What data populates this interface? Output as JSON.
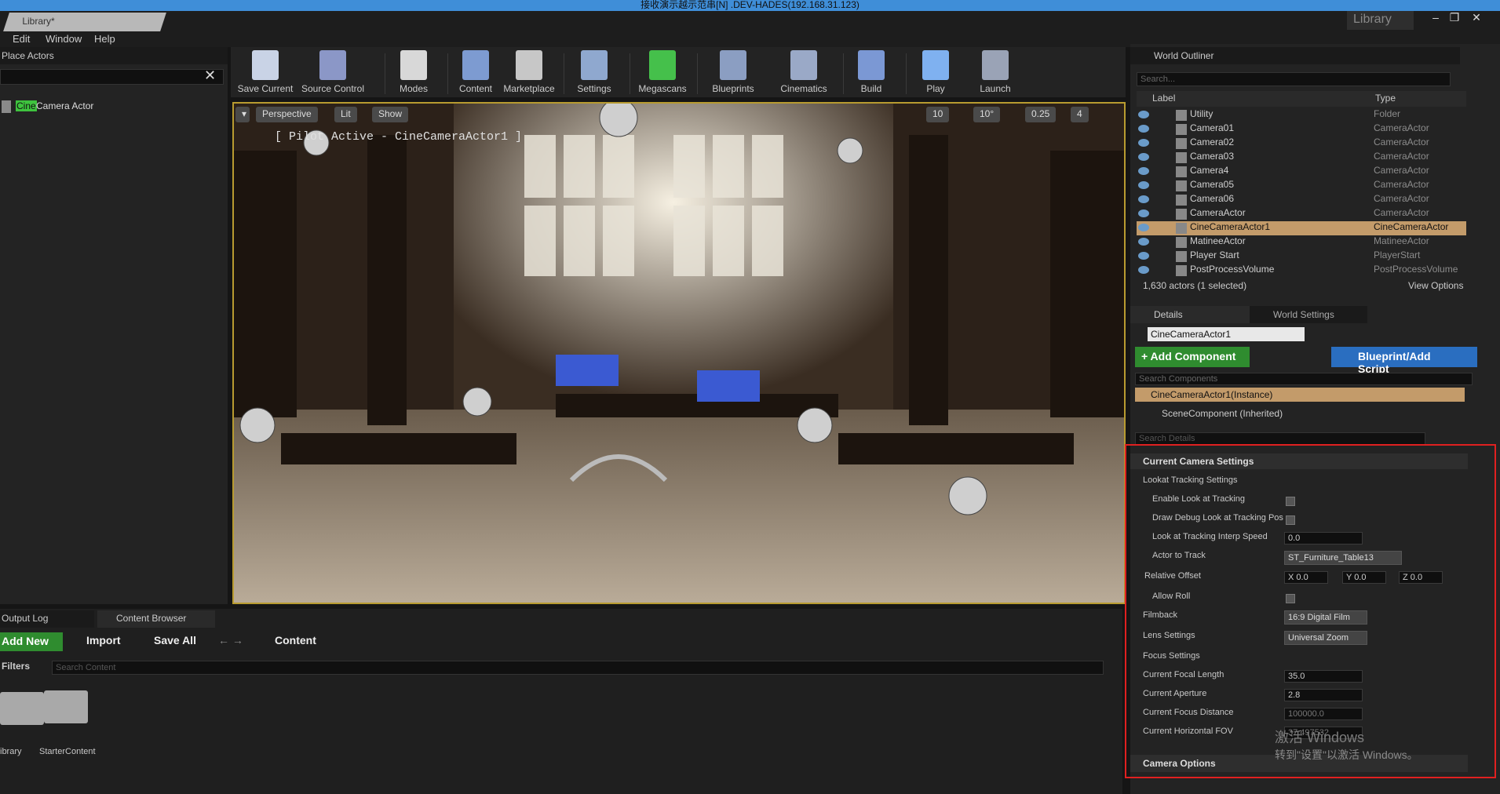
{
  "window": {
    "title": "接收演示越示范串[N] .DEV-HADES(192.168.31.123)",
    "library_tab": "Library*",
    "library_right": "Library"
  },
  "menu": [
    "Edit",
    "Window",
    "Help"
  ],
  "place_actors": {
    "tab": "Place Actors",
    "item_highlight": "Cine",
    "item_rest": " Camera Actor"
  },
  "toolbar": [
    {
      "label": "Save Current",
      "icon": "save-icon",
      "color": "#c9d3e6"
    },
    {
      "label": "Source Control",
      "icon": "source-control-icon",
      "color": "#8b97c7"
    },
    {
      "label": "Modes",
      "icon": "modes-icon",
      "color": "#d8d8d8"
    },
    {
      "label": "Content",
      "icon": "content-icon",
      "color": "#7d9bd1"
    },
    {
      "label": "Marketplace",
      "icon": "marketplace-icon",
      "color": "#c7c7c7"
    },
    {
      "label": "Settings",
      "icon": "settings-icon",
      "color": "#8fa8cf"
    },
    {
      "label": "Megascans",
      "icon": "megascans-icon",
      "color": "#45c04b"
    },
    {
      "label": "Blueprints",
      "icon": "blueprints-icon",
      "color": "#8b9ec2"
    },
    {
      "label": "Cinematics",
      "icon": "cinematics-icon",
      "color": "#9aa9c7"
    },
    {
      "label": "Build",
      "icon": "build-icon",
      "color": "#7b98d4"
    },
    {
      "label": "Play",
      "icon": "play-icon",
      "color": "#7fb1f0"
    },
    {
      "label": "Launch",
      "icon": "launch-icon",
      "color": "#9aa3b6"
    }
  ],
  "viewport": {
    "perspective": "Perspective",
    "lit": "Lit",
    "show": "Show",
    "pilot_text": "[ Pilot Active - CineCameraActor1 ]",
    "snap_grid": "10",
    "snap_rot": "10°",
    "snap_scale": "0.25",
    "cam_speed": "4"
  },
  "outliner": {
    "tab": "World Outliner",
    "search_placeholder": "Search...",
    "col_label": "Label",
    "col_type": "Type",
    "rows": [
      {
        "label": "Utility",
        "type": "Folder"
      },
      {
        "label": "Camera01",
        "type": "CameraActor"
      },
      {
        "label": "Camera02",
        "type": "CameraActor"
      },
      {
        "label": "Camera03",
        "type": "CameraActor"
      },
      {
        "label": "Camera4",
        "type": "CameraActor"
      },
      {
        "label": "Camera05",
        "type": "CameraActor"
      },
      {
        "label": "Camera06",
        "type": "CameraActor"
      },
      {
        "label": "CameraActor",
        "type": "CameraActor"
      },
      {
        "label": "CineCameraActor1",
        "type": "CineCameraActor"
      },
      {
        "label": "MatineeActor",
        "type": "MatineeActor"
      },
      {
        "label": "Player Start",
        "type": "PlayerStart"
      },
      {
        "label": "PostProcessVolume",
        "type": "PostProcessVolume"
      }
    ],
    "status": "1,630 actors (1 selected)",
    "view_options": "View Options"
  },
  "details": {
    "tab_details": "Details",
    "tab_world": "World Settings",
    "actor_name": "CineCameraActor1",
    "add_component": "+ Add Component",
    "blueprint_script": "Blueprint/Add Script",
    "search_components": "Search Components",
    "instance": "CineCameraActor1(Instance)",
    "scene_component": "SceneComponent (Inherited)",
    "search_details": "Search Details",
    "current_camera_settings": "Current Camera Settings",
    "lookat_tracking": "Lookat Tracking Settings",
    "enable_look": "Enable Look at Tracking",
    "draw_debug": "Draw Debug Look at Tracking Pos",
    "interp_speed_label": "Look at Tracking Interp Speed",
    "interp_speed": "0.0",
    "actor_to_track_label": "Actor to Track",
    "actor_to_track": "ST_Furniture_Table13",
    "relative_offset_label": "Relative Offset",
    "offset_x": "X 0.0",
    "offset_y": "Y 0.0",
    "offset_z": "Z 0.0",
    "allow_roll": "Allow Roll",
    "filmback_label": "Filmback",
    "filmback": "16:9 Digital Film",
    "lens_label": "Lens Settings",
    "lens": "Universal Zoom",
    "focus_label": "Focus Settings",
    "focal_label": "Current Focal Length",
    "focal": "35.0",
    "aperture_label": "Current Aperture",
    "aperture": "2.8",
    "focus_dist_label": "Current Focus Distance",
    "focus_dist": "100000.0",
    "hfov_label": "Current Horizontal FOV",
    "hfov": "37.497532",
    "camera_options": "Camera Options",
    "watermark1": "激活 Windows",
    "watermark2": "转到\"设置\"以激活 Windows。"
  },
  "bottom": {
    "tab_output": "Output Log",
    "tab_content": "Content Browser",
    "add_new": "Add New",
    "import": "Import",
    "save_all": "Save All",
    "content": "Content",
    "filters": "Filters",
    "search_placeholder": "Search Content",
    "folders": [
      "ibrary",
      "StarterContent"
    ]
  }
}
